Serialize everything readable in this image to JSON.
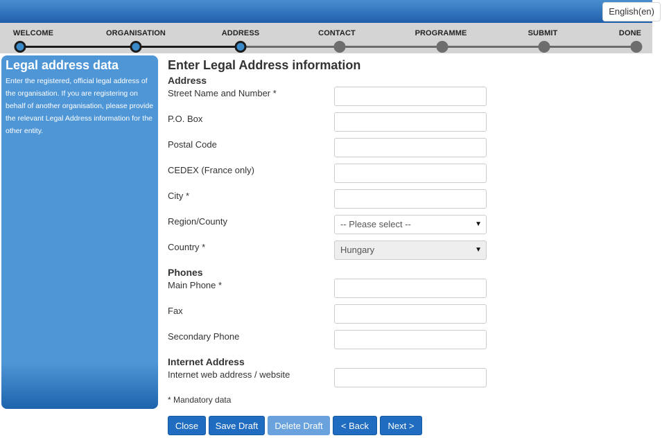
{
  "header": {
    "language": "English(en)"
  },
  "steps": [
    {
      "label": "WELCOME",
      "done": true
    },
    {
      "label": "ORGANISATION",
      "done": true
    },
    {
      "label": "ADDRESS",
      "done": true
    },
    {
      "label": "CONTACT",
      "done": false
    },
    {
      "label": "PROGRAMME",
      "done": false
    },
    {
      "label": "SUBMIT",
      "done": false
    },
    {
      "label": "DONE",
      "done": false
    }
  ],
  "sidebar": {
    "title": "Legal address data",
    "text": "Enter the registered, official legal address of the organisation. If you are registering on behalf of another organisation, please provide the relevant Legal Address information for the other entity."
  },
  "form": {
    "title": "Enter Legal Address information",
    "sections": {
      "address": "Address",
      "phones": "Phones",
      "internet": "Internet Address"
    },
    "fields": {
      "street": {
        "label": "Street Name and Number *",
        "value": ""
      },
      "pobox": {
        "label": "P.O. Box",
        "value": ""
      },
      "postal": {
        "label": "Postal Code",
        "value": ""
      },
      "cedex": {
        "label": "CEDEX (France only)",
        "value": ""
      },
      "city": {
        "label": "City *",
        "value": ""
      },
      "region": {
        "label": "Region/County",
        "value": "-- Please select --"
      },
      "country": {
        "label": "Country *",
        "value": "Hungary"
      },
      "main_phone": {
        "label": "Main Phone *",
        "value": ""
      },
      "fax": {
        "label": "Fax",
        "value": ""
      },
      "secondary_phone": {
        "label": "Secondary Phone",
        "value": ""
      },
      "website": {
        "label": "Internet web address / website",
        "value": ""
      }
    },
    "mandatory_note": "* Mandatory data"
  },
  "buttons": {
    "close": "Close",
    "save_draft": "Save Draft",
    "delete_draft": "Delete Draft",
    "back": "< Back",
    "next": "Next >"
  },
  "icons": {
    "dropdown": "caret-down-icon"
  },
  "colors": {
    "accent": "#1f6cc0",
    "panel": "#4f96d6",
    "header": "#2a6fba"
  }
}
